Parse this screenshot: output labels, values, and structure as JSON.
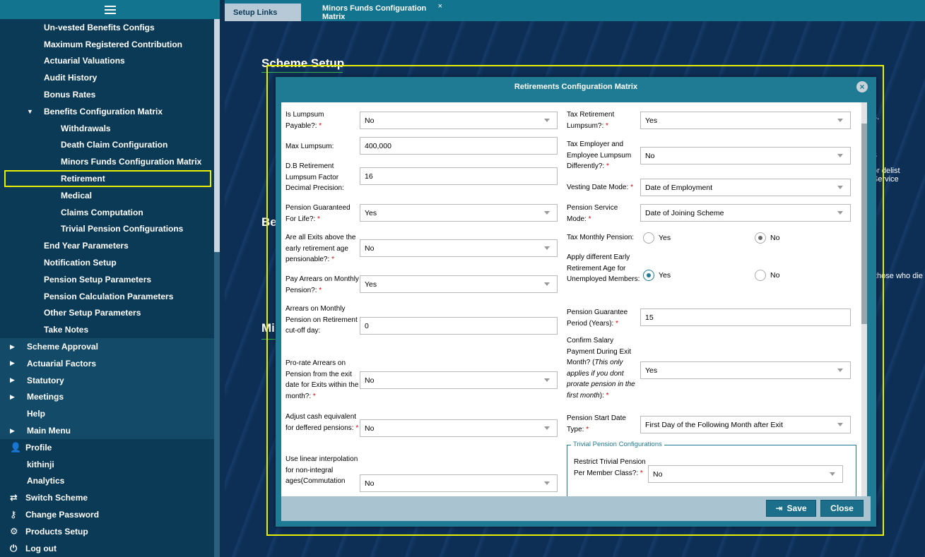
{
  "sidebar": {
    "items": [
      {
        "label": "Un-vested Benefits Configs"
      },
      {
        "label": "Maximum Registered Contribution"
      },
      {
        "label": "Actuarial Valuations"
      },
      {
        "label": "Audit History"
      },
      {
        "label": "Bonus Rates"
      },
      {
        "label": "Benefits Configuration Matrix"
      },
      {
        "label": "Withdrawals"
      },
      {
        "label": "Death Claim Configuration"
      },
      {
        "label": "Minors Funds Configuration Matrix"
      },
      {
        "label": "Retirement"
      },
      {
        "label": "Medical"
      },
      {
        "label": "Claims Computation"
      },
      {
        "label": "Trivial Pension Configurations"
      },
      {
        "label": "End Year Parameters"
      },
      {
        "label": "Notification Setup"
      },
      {
        "label": "Pension Setup Parameters"
      },
      {
        "label": "Pension Calculation Parameters"
      },
      {
        "label": "Other Setup Parameters"
      },
      {
        "label": "Take Notes"
      },
      {
        "label": "Scheme Approval"
      },
      {
        "label": "Actuarial Factors"
      },
      {
        "label": "Statutory"
      },
      {
        "label": "Meetings"
      },
      {
        "label": "Help"
      },
      {
        "label": "Main Menu"
      },
      {
        "label": "Profile"
      },
      {
        "label": "kithinji"
      },
      {
        "label": "Analytics"
      },
      {
        "label": "Switch Scheme"
      },
      {
        "label": "Change Password"
      },
      {
        "label": "Products Setup"
      },
      {
        "label": "Log out"
      }
    ]
  },
  "tabs": {
    "setup_links": "Setup Links",
    "minors": "Minors Funds Configuration Matrix",
    "close": "×"
  },
  "background": {
    "scheme_setup": "Scheme Setup",
    "be": "Be",
    "mi": "Mi",
    "frag1": "s.",
    "frag2": "s",
    "frag3": "or delist Service",
    "frag4": "those who die i"
  },
  "modal": {
    "title": "Retirements Configuration Matrix",
    "close_icon": "×",
    "left": {
      "is_lumpsum_payable": {
        "label": "Is Lumpsum Payable?:",
        "value": "No"
      },
      "max_lumpsum": {
        "label": "Max Lumpsum:",
        "value": "400,000"
      },
      "db_factor": {
        "label": "D.B Retirement Lumpsum Factor Decimal Precision:",
        "value": "16"
      },
      "pension_guaranteed": {
        "label": "Pension Guaranteed For Life?:",
        "value": "Yes"
      },
      "exits_pensionable": {
        "label": "Are all Exits above the early retirement age pensionable?:",
        "value": "No"
      },
      "pay_arrears": {
        "label": "Pay Arrears on Monthly Pension?:",
        "value": "Yes"
      },
      "arrears_cutoff": {
        "label": "Arrears on Monthly Pension on Retirement cut-off day:",
        "value": "0"
      },
      "prorate_arrears": {
        "label": "Pro-rate Arrears on Pension from the exit date for Exits within the month?:",
        "value": "No"
      },
      "adjust_cash": {
        "label": "Adjust cash equivalent for deffered pensions:",
        "value": "No"
      },
      "linear_interp": {
        "label": "Use linear interpolation for non-integral ages(Commutation",
        "value": "No"
      }
    },
    "right": {
      "tax_ret_lumpsum": {
        "label": "Tax Retirement Lumpsum?:",
        "value": "Yes"
      },
      "tax_employer": {
        "label": "Tax Employer and Employee Lumpsum Differently?:",
        "value": "No"
      },
      "vesting_date_mode": {
        "label": "Vesting Date Mode:",
        "value": "Date of Employment"
      },
      "pension_service_mode": {
        "label": "Pension Service Mode:",
        "value": "Date of Joining Scheme"
      },
      "tax_monthly_pension": {
        "label": "Tax Monthly Pension:",
        "yes": "Yes",
        "no": "No",
        "selected": "No"
      },
      "early_ret_age": {
        "label": "Apply different Early Retirement Age for Unemployed Members:",
        "yes": "Yes",
        "no": "No",
        "selected": "Yes"
      },
      "guarantee_period": {
        "label": "Pension Guarantee Period (Years):",
        "value": "15"
      },
      "confirm_salary": {
        "label_main": "Confirm Salary Payment During Exit Month? (",
        "label_italic": "This only applies if you dont prorate pension in the first month",
        "label_end": "):",
        "value": "Yes"
      },
      "pension_start_type": {
        "label": "Pension Start Date Type:",
        "value": "First Day of the Following Month after Exit"
      }
    },
    "trivial": {
      "legend": "Trivial Pension Configurations",
      "restrict": {
        "label": "Restrict Trivial Pension Per Member Class?:",
        "value": "No"
      }
    },
    "required_mark": "*",
    "buttons": {
      "save": "Save",
      "close": "Close"
    }
  }
}
